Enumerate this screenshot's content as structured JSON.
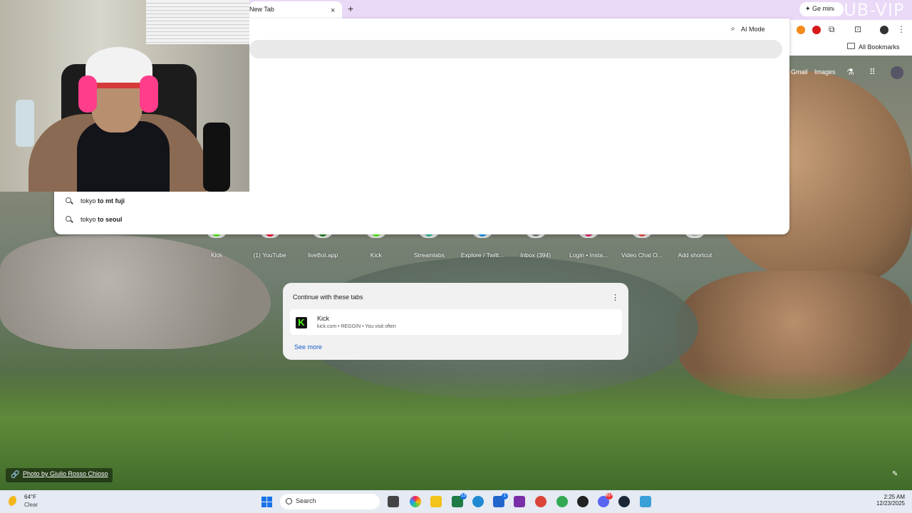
{
  "browser": {
    "tab_title": "New Tab",
    "tab_close": "×",
    "new_tab": "+",
    "gemini_label": "Ge mini",
    "watermark": "SUB-VIP",
    "ai_mode": "AI Mode",
    "all_bookmarks": "All Bookmarks"
  },
  "google_links": {
    "gmail": "Gmail",
    "images": "Images"
  },
  "suggestions": [
    {
      "prefix": "tokyo ",
      "bold": "to mt fuji"
    },
    {
      "prefix": "tokyo ",
      "bold": "to seoul"
    }
  ],
  "shortcuts": [
    {
      "label": "Kick",
      "color": "#53fc18"
    },
    {
      "label": "(1) YouTube",
      "color": "#ff0033"
    },
    {
      "label": "liveBot.app",
      "color": "#2d8a2d"
    },
    {
      "label": "Kick",
      "color": "#53fc18"
    },
    {
      "label": "Streamlabs",
      "color": "#31c3a2"
    },
    {
      "label": "Explore / Twitt...",
      "color": "#1d9bf0"
    },
    {
      "label": "Inbox (394)",
      "color": "#888888"
    },
    {
      "label": "Login • Insta...",
      "color": "#e1306c"
    },
    {
      "label": "Video Chat O...",
      "color": "#f25c54"
    },
    {
      "label": "Add shortcut",
      "color": "#cccccc"
    }
  ],
  "continue_card": {
    "title": "Continue with these tabs",
    "menu": "⋮",
    "item_title": "Kick",
    "item_sub": "kick.com • REGGIN • You visit often",
    "logo_letter": "K",
    "see_more": "See more"
  },
  "photo_credit": "Photo by Giulio Rosso Chioso",
  "taskbar": {
    "temp": "64°F",
    "condition": "Clear",
    "search": "Search",
    "time": "2:25 AM",
    "date": "12/23/2025",
    "badges": [
      "13",
      "1",
      "99+"
    ]
  },
  "colors": {
    "tabstrip": "#e9d9f7",
    "taskbar": "#e5eaf3",
    "link": "#1a5cc8"
  }
}
